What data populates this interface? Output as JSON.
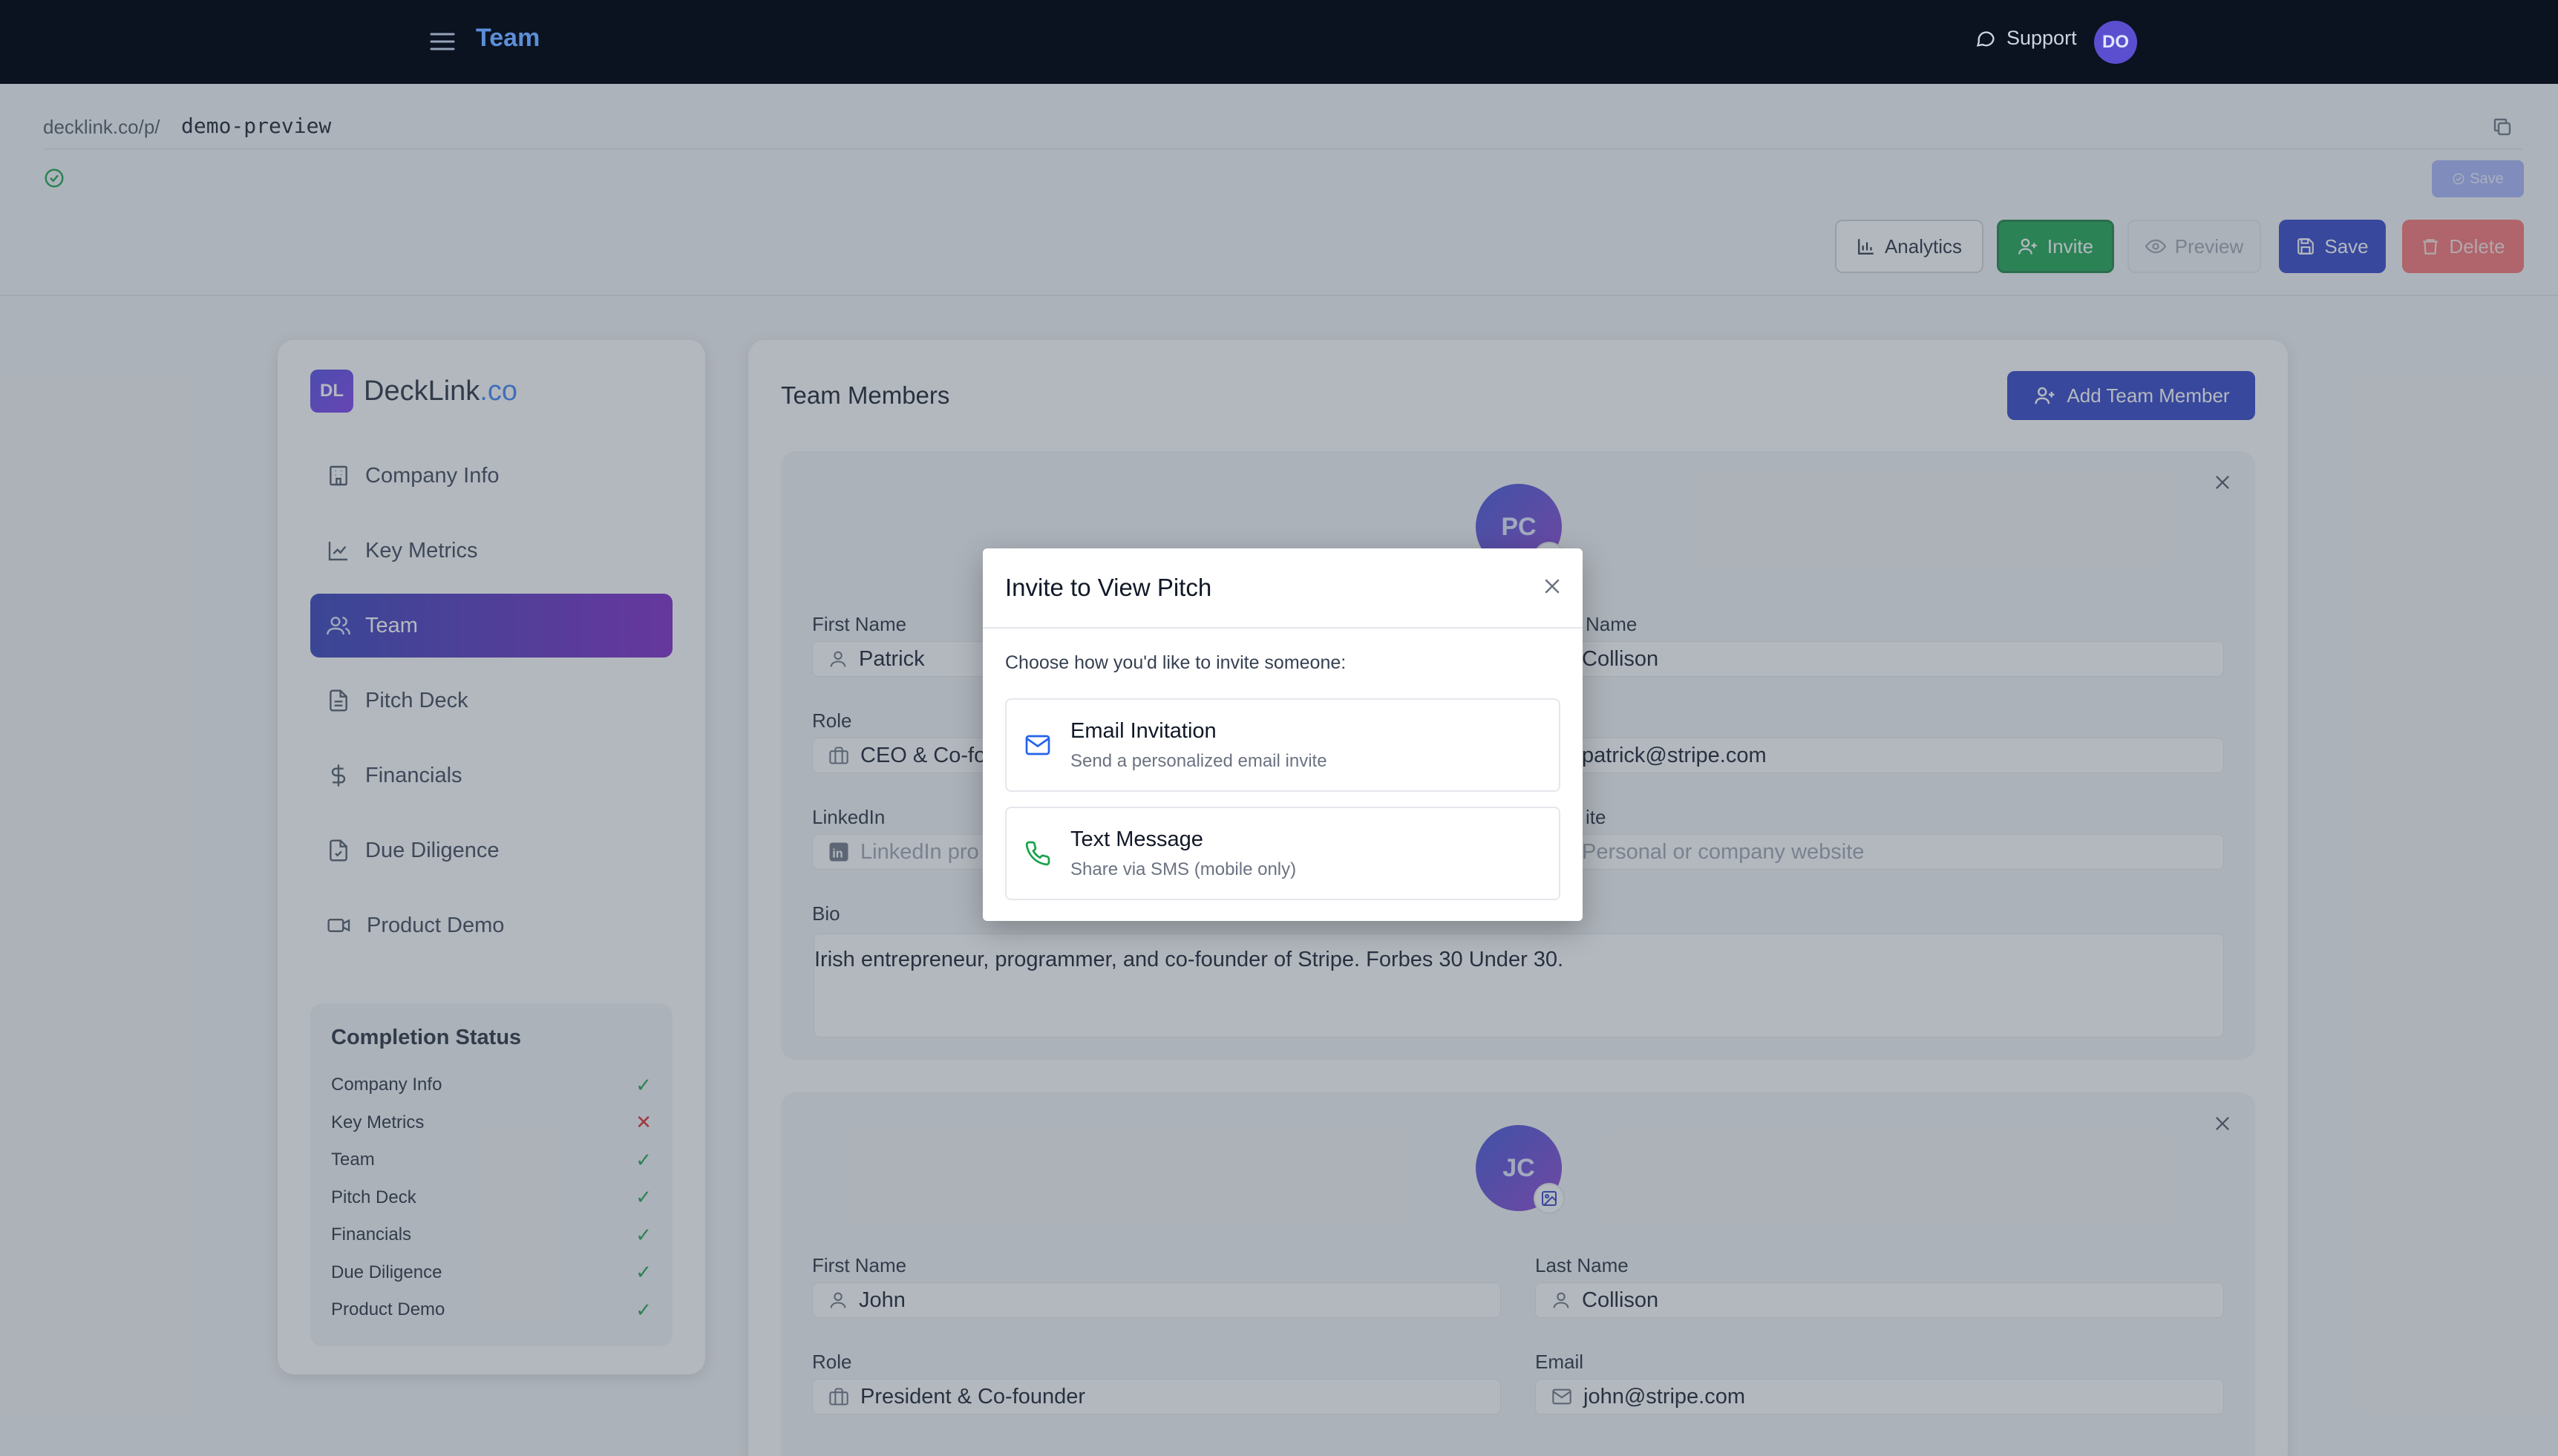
{
  "topbar": {
    "title": "Team",
    "support_label": "Support",
    "avatar_initials": "DO"
  },
  "url": {
    "prefix": "decklink.co/p/",
    "slug": "demo-preview"
  },
  "mini_save_label": "Save",
  "actions": {
    "analytics": "Analytics",
    "invite": "Invite",
    "preview": "Preview",
    "save": "Save",
    "delete": "Delete"
  },
  "sidebar": {
    "logo_initials": "DL",
    "logo_name": "DeckLink",
    "logo_suffix": ".co",
    "items": [
      {
        "label": "Company Info",
        "icon": "building-icon"
      },
      {
        "label": "Key Metrics",
        "icon": "chart-line-icon"
      },
      {
        "label": "Team",
        "icon": "users-icon"
      },
      {
        "label": "Pitch Deck",
        "icon": "document-icon"
      },
      {
        "label": "Financials",
        "icon": "dollar-icon"
      },
      {
        "label": "Due Diligence",
        "icon": "file-check-icon"
      },
      {
        "label": "Product Demo",
        "icon": "video-icon"
      }
    ],
    "active_index": 2,
    "status": {
      "title": "Completion Status",
      "rows": [
        {
          "label": "Company Info",
          "mark": "✓"
        },
        {
          "label": "Key Metrics",
          "mark": "✕"
        },
        {
          "label": "Team",
          "mark": "✓"
        },
        {
          "label": "Pitch Deck",
          "mark": "✓"
        },
        {
          "label": "Financials",
          "mark": "✓"
        },
        {
          "label": "Due Diligence",
          "mark": "✓"
        },
        {
          "label": "Product Demo",
          "mark": "✓"
        }
      ]
    }
  },
  "main": {
    "title": "Team Members",
    "add_button": "Add Team Member",
    "members": [
      {
        "initials": "PC",
        "first_name_label": "First Name",
        "first_name": "Patrick",
        "last_name_label": "Name",
        "last_name": "Collison",
        "role_label": "Role",
        "role": "CEO & Co-fo",
        "email": "patrick@stripe.com",
        "linkedin_label": "LinkedIn",
        "linkedin_placeholder": "LinkedIn pro",
        "website_label": "ite",
        "website_placeholder": "Personal or company website",
        "bio_label": "Bio",
        "bio": "Irish entrepreneur, programmer, and co-founder of Stripe. Forbes 30 Under 30."
      },
      {
        "initials": "JC",
        "first_name_label": "First Name",
        "first_name": "John",
        "last_name_label": "Last Name",
        "last_name": "Collison",
        "role_label": "Role",
        "role": "President & Co-founder",
        "email_label": "Email",
        "email": "john@stripe.com"
      }
    ]
  },
  "modal": {
    "title": "Invite to View Pitch",
    "description": "Choose how you'd like to invite someone:",
    "options": [
      {
        "title": "Email Invitation",
        "subtitle": "Send a personalized email invite",
        "icon": "mail-icon"
      },
      {
        "title": "Text Message",
        "subtitle": "Share via SMS (mobile only)",
        "icon": "phone-icon"
      }
    ]
  }
}
